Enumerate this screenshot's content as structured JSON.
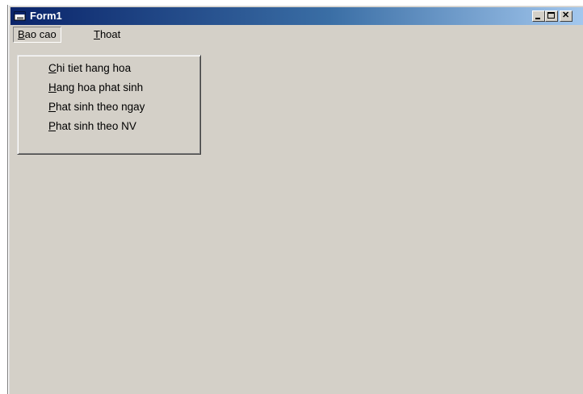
{
  "window": {
    "title": "Form1",
    "icon": "form-window-icon"
  },
  "menubar": {
    "items": [
      {
        "accel": "B",
        "rest": "ao cao"
      },
      {
        "accel": "T",
        "rest": "hoat"
      }
    ]
  },
  "dropdown": {
    "items": [
      {
        "accel": "C",
        "rest": "hi tiet hang hoa"
      },
      {
        "accel": "H",
        "rest": "ang hoa phat sinh"
      },
      {
        "accel": "P",
        "rest": "hat sinh theo ngay"
      },
      {
        "accel": "P",
        "rest": "hat sinh theo NV"
      }
    ]
  }
}
